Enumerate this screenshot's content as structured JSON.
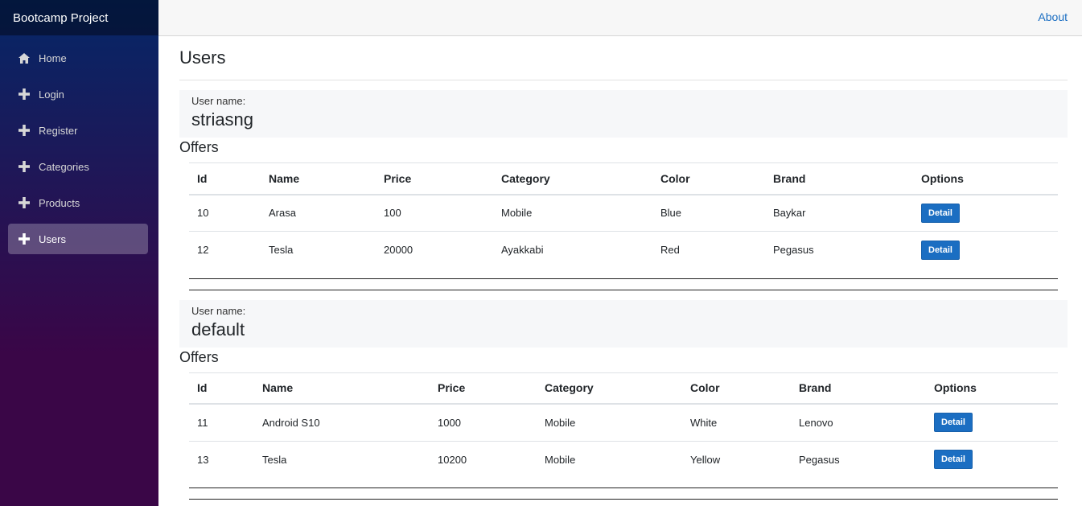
{
  "app": {
    "brand": "Bootcamp Project",
    "about_link": "About"
  },
  "sidebar": {
    "items": [
      {
        "label": "Home",
        "icon": "home-icon",
        "active": false
      },
      {
        "label": "Login",
        "icon": "plus-icon",
        "active": false
      },
      {
        "label": "Register",
        "icon": "plus-icon",
        "active": false
      },
      {
        "label": "Categories",
        "icon": "plus-icon",
        "active": false
      },
      {
        "label": "Products",
        "icon": "plus-icon",
        "active": false
      },
      {
        "label": "Users",
        "icon": "plus-icon",
        "active": true
      }
    ]
  },
  "page": {
    "title": "Users"
  },
  "users": [
    {
      "label": "User name:",
      "name": "striasng",
      "offers_heading": "Offers",
      "columns": [
        "Id",
        "Name",
        "Price",
        "Category",
        "Color",
        "Brand",
        "Options"
      ],
      "rows": [
        {
          "id": "10",
          "name": "Arasa",
          "price": "100",
          "category": "Mobile",
          "color": "Blue",
          "brand": "Baykar",
          "button": "Detail"
        },
        {
          "id": "12",
          "name": "Tesla",
          "price": "20000",
          "category": "Ayakkabi",
          "color": "Red",
          "brand": "Pegasus",
          "button": "Detail"
        }
      ]
    },
    {
      "label": "User name:",
      "name": "default",
      "offers_heading": "Offers",
      "columns": [
        "Id",
        "Name",
        "Price",
        "Category",
        "Color",
        "Brand",
        "Options"
      ],
      "rows": [
        {
          "id": "11",
          "name": "Android S10",
          "price": "1000",
          "category": "Mobile",
          "color": "White",
          "brand": "Lenovo",
          "button": "Detail"
        },
        {
          "id": "13",
          "name": "Tesla",
          "price": "10200",
          "category": "Mobile",
          "color": "Yellow",
          "brand": "Pegasus",
          "button": "Detail"
        }
      ]
    }
  ],
  "colors": {
    "accent": "#1b6ec2",
    "sidebar_top": "#052767",
    "sidebar_bottom": "#3a0647"
  }
}
